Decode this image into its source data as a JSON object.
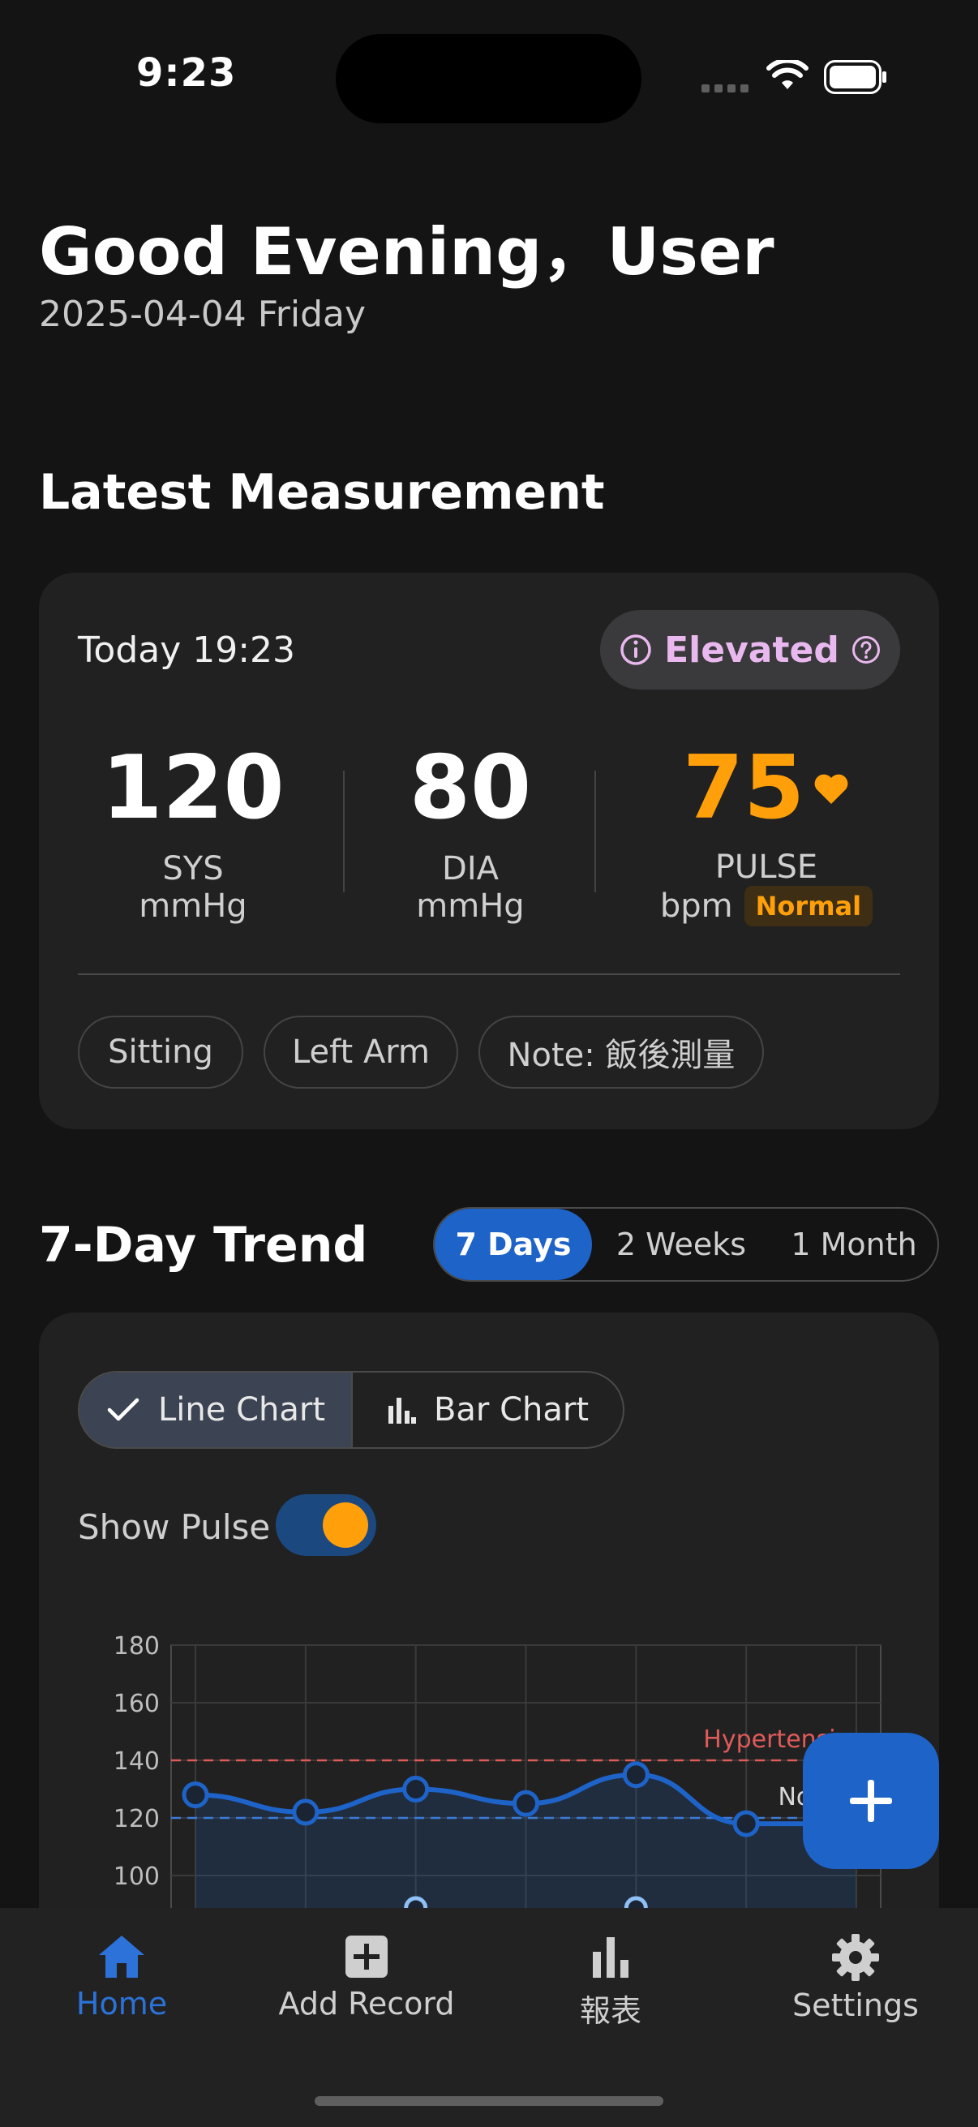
{
  "status_bar": {
    "time": "9:23"
  },
  "header": {
    "greeting": "Good Evening，User",
    "date": "2025-04-04 Friday"
  },
  "latest": {
    "section_title": "Latest Measurement",
    "time": "Today 19:23",
    "status": "Elevated",
    "sys": {
      "value": "120",
      "label": "SYS",
      "unit": "mmHg"
    },
    "dia": {
      "value": "80",
      "label": "DIA",
      "unit": "mmHg"
    },
    "pulse": {
      "value": "75",
      "label": "PULSE",
      "unit": "bpm",
      "badge": "Normal"
    },
    "tags": [
      "Sitting",
      "Left Arm",
      "Note: 飯後測量"
    ]
  },
  "trend": {
    "section_title": "7-Day Trend",
    "periods": [
      "7 Days",
      "2 Weeks",
      "1 Month"
    ],
    "active_period": "7 Days",
    "chart_types": [
      "Line Chart",
      "Bar Chart"
    ],
    "active_chart_type": "Line Chart",
    "show_pulse_label": "Show Pulse",
    "show_pulse_on": true
  },
  "chart_data": {
    "type": "line",
    "y_ticks": [
      "180",
      "160",
      "140",
      "120",
      "100"
    ],
    "ylim": [
      90,
      180
    ],
    "grid": true,
    "x_count": 7,
    "series": [
      {
        "values": [
          128,
          122,
          130,
          125,
          135,
          118,
          118
        ],
        "color": "#1e63c8"
      }
    ],
    "reference_lines": [
      {
        "label": "Hypertension",
        "value": 140,
        "color": "#e05a5a"
      },
      {
        "label": "Normal",
        "value": 120,
        "color": "#3b7bd8"
      }
    ],
    "pulse_points_visible_x": [
      2,
      4
    ]
  },
  "nav": {
    "items": [
      {
        "label": "Home",
        "icon": "home-icon"
      },
      {
        "label": "Add Record",
        "icon": "add-record-icon"
      },
      {
        "label": "報表",
        "icon": "bar-chart-icon"
      },
      {
        "label": "Settings",
        "icon": "gear-icon"
      }
    ],
    "active": "Home"
  },
  "colors": {
    "accent": "#1e63c8",
    "pulse": "#ff9f0a",
    "elevated": "#e9b8ee",
    "background": "#141414",
    "card": "#212121"
  }
}
